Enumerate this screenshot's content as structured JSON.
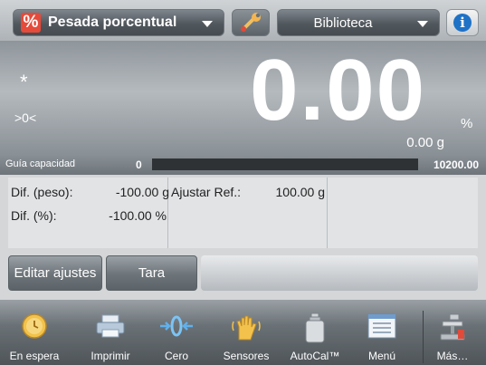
{
  "header": {
    "app_mode_icon": "%",
    "app_mode_label": "Pesada porcentual",
    "tools_icon": "wrench-icon",
    "library_label": "Biblioteca",
    "info_icon": "i"
  },
  "display": {
    "stable_indicator": "*",
    "zero_indicator": ">0<",
    "main_value": "0.00",
    "main_unit": "%",
    "sub_value": "0.00 g"
  },
  "capacity": {
    "label": "Guía capacidad",
    "min": "0",
    "max": "10200.00",
    "fill_fraction": 0
  },
  "data_fields": {
    "diff_weight_label": "Dif. (peso):",
    "diff_weight_value": "-100.00 g",
    "diff_percent_label": "Dif. (%):",
    "diff_percent_value": "-100.00 %",
    "adjust_ref_label": "Ajustar Ref.:",
    "adjust_ref_value": "100.00 g"
  },
  "actions": {
    "edit_settings": "Editar ajustes",
    "tare": "Tara"
  },
  "toolbar": {
    "items": [
      {
        "label": "En espera",
        "icon": "standby-clock-icon"
      },
      {
        "label": "Imprimir",
        "icon": "printer-icon"
      },
      {
        "label": "Cero",
        "icon": "zero-arrows-icon"
      },
      {
        "label": "Sensores",
        "icon": "hand-sensor-icon"
      },
      {
        "label": "AutoCal™",
        "icon": "calibration-weight-icon"
      },
      {
        "label": "Menú",
        "icon": "menu-list-icon"
      },
      {
        "label": "Más…",
        "icon": "more-scale-icon"
      }
    ]
  },
  "colors": {
    "app_icon_bg": "#e64a3a",
    "info_blue": "#1f72c6",
    "capacity_track": "#2f3235"
  }
}
